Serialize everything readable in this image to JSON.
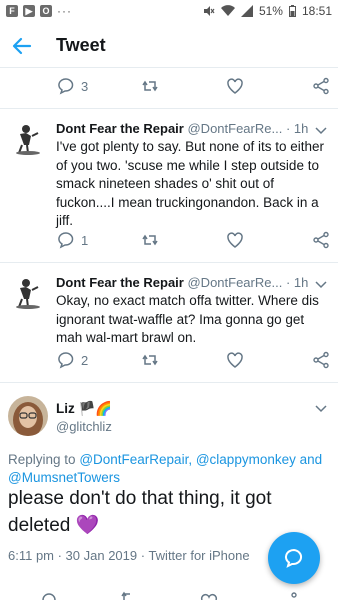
{
  "statusbar": {
    "app_icons": [
      "F",
      "▶",
      "O"
    ],
    "more": "···",
    "battery": "51%",
    "time": "18:51"
  },
  "header": {
    "title": "Tweet",
    "accent": "#1da1f2"
  },
  "top_actions": {
    "replies": "3"
  },
  "tweets": [
    {
      "name": "Dont Fear the Repair",
      "handle": "@DontFearRe...",
      "time": "· 1h",
      "text": "I've got plenty to say. But none of its to either of you two. 'scuse me while I step outside to smack nineteen shades o' shit out of fuckon....I mean truckingonandon. Back in a jiff.",
      "replies": "1"
    },
    {
      "name": "Dont Fear the Repair",
      "handle": "@DontFearRe...",
      "time": "· 1h",
      "text": "Okay, no exact match offa twitter. Where dis ignorant twat-waffle at? Ima gonna go get mah wal-mart brawl on.",
      "replies": "2"
    }
  ],
  "main_tweet": {
    "name": "Liz",
    "name_emojis": "🏴🌈",
    "handle": "@glitchliz",
    "replying_prefix": "Replying to",
    "replying_handles": [
      "@DontFearRepair,",
      "@clappymonkey",
      "and",
      "@MumsnetTowers"
    ],
    "text": "please don't do that thing, it got deleted 💜",
    "meta": "6:11 pm · 30 Jan 2019 · Twitter for iPhone"
  },
  "colors": {
    "link": "#1b95e0",
    "muted": "#657786",
    "fab": "#1da1f2"
  }
}
